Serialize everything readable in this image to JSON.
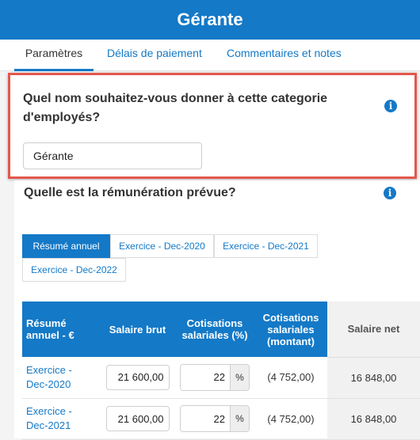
{
  "header": {
    "title": "Gérante"
  },
  "tabs": [
    {
      "label": "Paramètres",
      "active": true
    },
    {
      "label": "Délais de paiement",
      "active": false
    },
    {
      "label": "Commentaires et notes",
      "active": false
    }
  ],
  "question_name": {
    "line1": "Quel nom souhaitez-vous donner à cette categorie",
    "line2": "d'employés?",
    "info_icon": "i",
    "value": "Gérante"
  },
  "question_pay": {
    "text": "Quelle est la rémunération prévue?",
    "info_icon": "i"
  },
  "period_tabs": [
    {
      "label": "Résumé annuel",
      "active": true
    },
    {
      "label": "Exercice - Dec-2020",
      "active": false
    },
    {
      "label": "Exercice - Dec-2021",
      "active": false
    },
    {
      "label": "Exercice - Dec-2022",
      "active": false
    }
  ],
  "table": {
    "headers": {
      "col1": "Résumé annuel - €",
      "col2": "Salaire brut",
      "col3": "Cotisations salariales (%)",
      "col4": "Cotisations salariales (montant)",
      "col5": "Salaire net"
    },
    "percent_sign": "%",
    "rows": [
      {
        "label": "Exercice - Dec-2020",
        "gross": "21 600,00",
        "rate": "22",
        "contrib": "(4 752,00)",
        "net": "16 848,00"
      },
      {
        "label": "Exercice - Dec-2021",
        "gross": "21 600,00",
        "rate": "22",
        "contrib": "(4 752,00)",
        "net": "16 848,00"
      }
    ]
  }
}
